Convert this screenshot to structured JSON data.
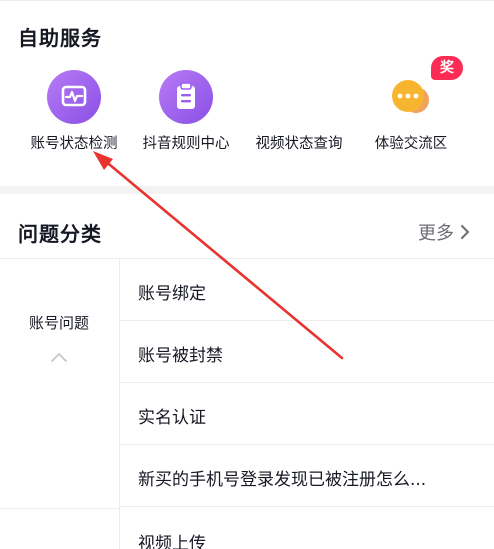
{
  "service": {
    "title": "自助服务",
    "items": [
      {
        "label": "账号状态检测",
        "icon": "account-status-icon"
      },
      {
        "label": "抖音规则中心",
        "icon": "rules-clipboard-icon"
      },
      {
        "label": "视频状态查询",
        "icon": "video-status-icon"
      },
      {
        "label": "体验交流区",
        "icon": "chat-bubble-icon"
      }
    ],
    "badge": "奖"
  },
  "category": {
    "title": "问题分类",
    "more_label": "更多",
    "left_item": "账号问题",
    "questions": [
      "账号绑定",
      "账号被封禁",
      "实名认证",
      "新买的手机号登录发现已被注册怎么...",
      "视频上传"
    ]
  },
  "colors": {
    "purple": "#9b5ef0",
    "orange": "#f7a928",
    "badge": "#fe2c55",
    "annotation_arrow": "#e8332f"
  }
}
